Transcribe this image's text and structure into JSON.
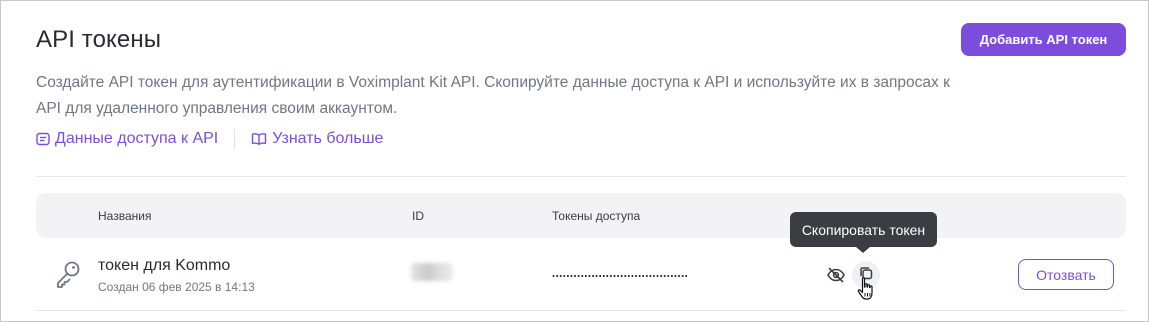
{
  "header": {
    "title": "API токены",
    "add_button_label": "Добавить API токен"
  },
  "description": "Создайте API токен для аутентификации в Voximplant Kit API. Скопируйте данные доступа к API и используйте их в запросах к API для удаленного управления своим аккаунтом.",
  "links": {
    "access_data": {
      "label": "Данные доступа к API",
      "icon": "document-icon"
    },
    "learn_more": {
      "label": "Узнать больше",
      "icon": "book-icon"
    }
  },
  "table": {
    "columns": {
      "name": "Названия",
      "id": "ID",
      "tokens": "Токены доступа"
    },
    "rows": [
      {
        "icon": "key-icon",
        "name": "токен для Kommo",
        "created": "Создан 06 фев 2025 в 14:13",
        "token_masked": "......................................",
        "revoke_label": "Отозвать"
      }
    ]
  },
  "tooltip": "Скопировать токен",
  "colors": {
    "accent": "#7c4ddc",
    "tooltip_bg": "#3a3d42",
    "muted_text": "#6d7785"
  }
}
